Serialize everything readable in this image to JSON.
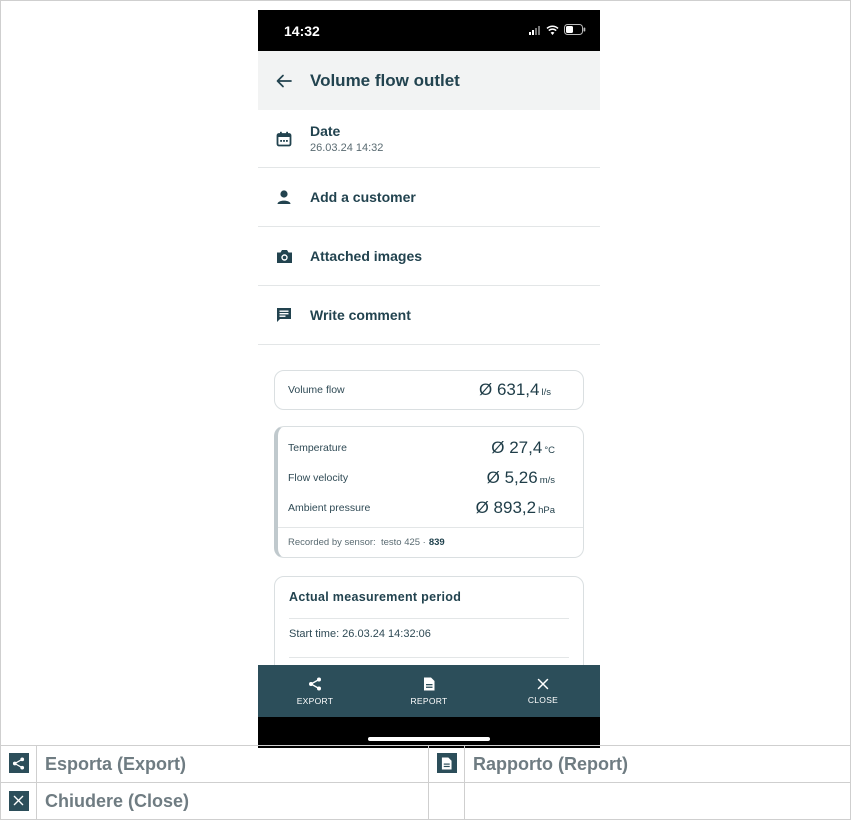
{
  "status_bar": {
    "time": "14:32"
  },
  "header": {
    "title": "Volume flow outlet",
    "back_icon": "arrow-left-icon"
  },
  "menu": {
    "date_label": "Date",
    "date_value": "26.03.24 14:32",
    "customer_label": "Add a customer",
    "images_label": "Attached images",
    "comment_label": "Write comment"
  },
  "volume_card": {
    "label": "Volume flow",
    "value": "Ø 631,4",
    "unit": "l/s"
  },
  "measurements": [
    {
      "label": "Temperature",
      "value": "Ø 27,4",
      "unit": "°C"
    },
    {
      "label": "Flow velocity",
      "value": "Ø 5,26",
      "unit": "m/s"
    },
    {
      "label": "Ambient pressure",
      "value": "Ø 893,2",
      "unit": "hPa"
    }
  ],
  "sensor": {
    "prefix": "Recorded by sensor:",
    "name": "testo 425 ·",
    "id": "839"
  },
  "period": {
    "title": "Actual measurement period",
    "start": "Start time: 26.03.24 14:32:06"
  },
  "bottom_bar": {
    "export": "EXPORT",
    "report": "REPORT",
    "close": "CLOSE"
  },
  "legend": {
    "export": "Esporta (Export)",
    "report": "Rapporto (Report)",
    "close": "Chiudere (Close)"
  },
  "colors": {
    "primary": "#2c4e5a",
    "text_dark": "#22434f",
    "header_bg": "#f2f3f3",
    "legend_text": "#6f7c82"
  }
}
